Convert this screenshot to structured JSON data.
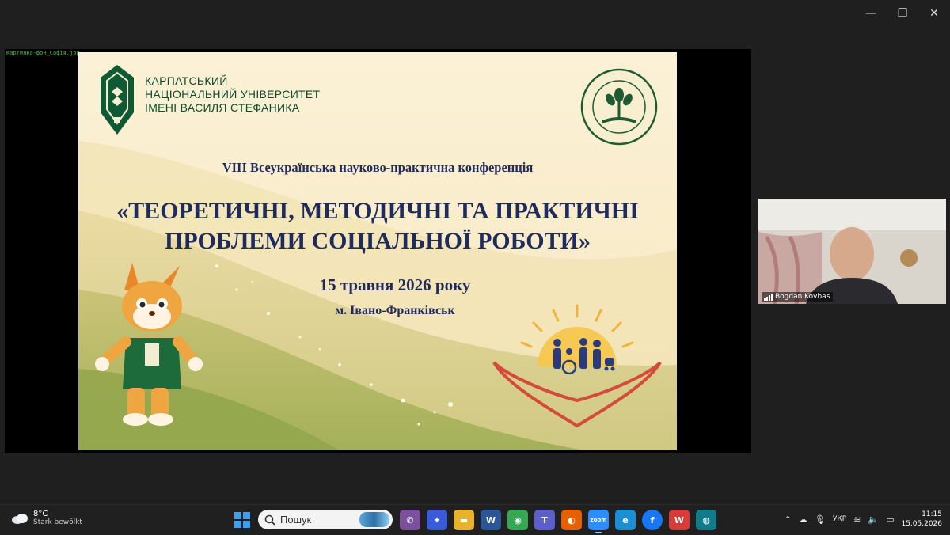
{
  "window_controls": {
    "minimize": "—",
    "restore": "❐",
    "close": "✕"
  },
  "share": {
    "file_label": "Картинка-фон_Софія.jpg"
  },
  "slide": {
    "university": [
      "КАРПАТСЬКИЙ",
      "НАЦІОНАЛЬНИЙ УНІВЕРСИТЕТ",
      "ІМЕНІ ВАСИЛЯ СТЕФАНИКА"
    ],
    "conference": "VIII Всеукраїнська науково-практична конференція",
    "title": [
      "«ТЕОРЕТИЧНІ, МЕТОДИЧНІ ТА ПРАКТИЧНІ",
      "ПРОБЛЕМИ СОЦІАЛЬНОЇ РОБОТИ»"
    ],
    "date": "15  травня 2026 року",
    "city": "м. Івано-Франківськ"
  },
  "participant": {
    "name": "Bogdan Kovbas"
  },
  "taskbar": {
    "weather_temp": "8°C",
    "weather_desc": "Stark bewölkt",
    "search_placeholder": "Пошук",
    "language": "УКР",
    "time": "11:15",
    "date": "15.05.2026",
    "apps": [
      {
        "name": "viber",
        "glyph": "✆",
        "color": "#7b519d"
      },
      {
        "name": "copilot",
        "glyph": "✦",
        "color": "#3a5bd9"
      },
      {
        "name": "explorer",
        "glyph": "▬",
        "color": "#e8b22c"
      },
      {
        "name": "word",
        "glyph": "W",
        "color": "#2b5797"
      },
      {
        "name": "chrome",
        "glyph": "◉",
        "color": "#34a853"
      },
      {
        "name": "teams",
        "glyph": "T",
        "color": "#5b5fc7"
      },
      {
        "name": "firefox",
        "glyph": "◐",
        "color": "#e66000"
      },
      {
        "name": "zoom",
        "glyph": "zoom",
        "color": "#2d8cff"
      },
      {
        "name": "edge",
        "glyph": "e",
        "color": "#1b8fd6"
      },
      {
        "name": "facebook",
        "glyph": "f",
        "color": "#1877f2"
      },
      {
        "name": "wps",
        "glyph": "W",
        "color": "#d93a3a"
      },
      {
        "name": "webex",
        "glyph": "◍",
        "color": "#0f7c8a"
      }
    ]
  }
}
